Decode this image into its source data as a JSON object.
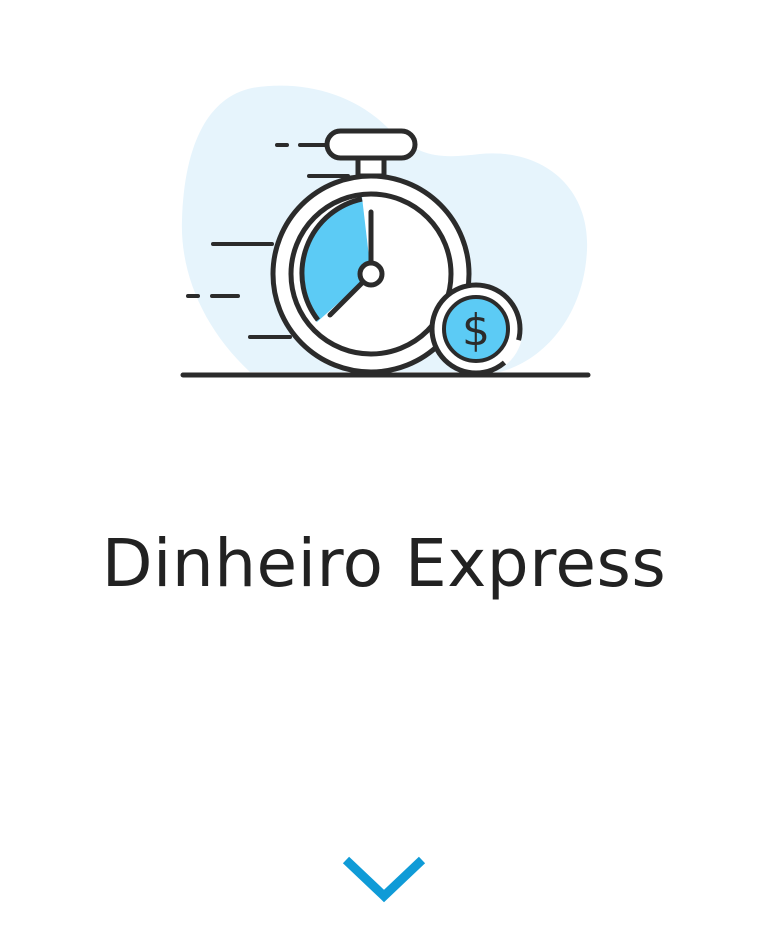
{
  "title": "Dinheiro Express",
  "hero": {
    "icon": "stopwatch-money-icon",
    "currency_symbol": "$"
  },
  "scroll": {
    "icon": "chevron-down-icon"
  },
  "colors": {
    "accent": "#0f9bd7",
    "highlight": "#5ccbf5",
    "blob": "#e6f4fc",
    "outline": "#2b2b2b",
    "text": "#222222"
  }
}
